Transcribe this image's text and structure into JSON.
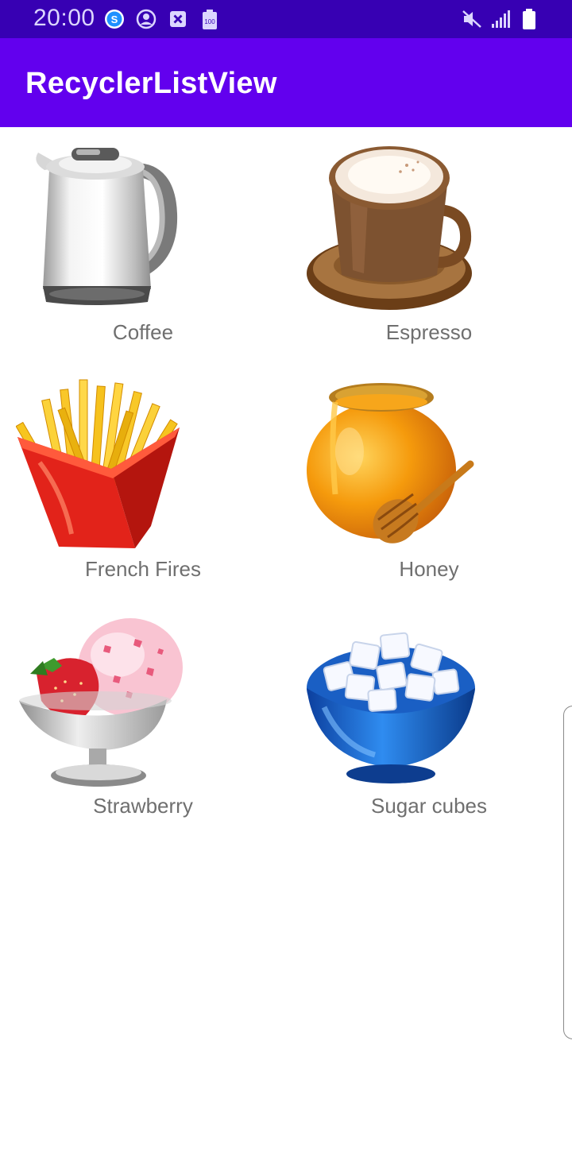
{
  "status_bar": {
    "time": "20:00",
    "left_icons": [
      "skype-icon",
      "account-circle-icon",
      "close-box-icon",
      "battery-saver-icon"
    ],
    "right_icons": [
      "mute-icon",
      "signal-icon",
      "battery-icon"
    ],
    "battery_saver_text": "100"
  },
  "app_bar": {
    "title": "RecyclerListView"
  },
  "items": [
    {
      "label": "Coffee",
      "icon": "kettle-icon"
    },
    {
      "label": "Espresso",
      "icon": "cappuccino-cup-icon"
    },
    {
      "label": "French Fires",
      "icon": "french-fries-icon"
    },
    {
      "label": "Honey",
      "icon": "honey-pot-icon"
    },
    {
      "label": "Strawberry",
      "icon": "strawberry-ice-cream-icon"
    },
    {
      "label": "Sugar cubes",
      "icon": "sugar-bowl-icon"
    }
  ],
  "colors": {
    "status_bar": "#3700b3",
    "app_bar": "#6200ee",
    "label_text": "#6f6f6f"
  }
}
